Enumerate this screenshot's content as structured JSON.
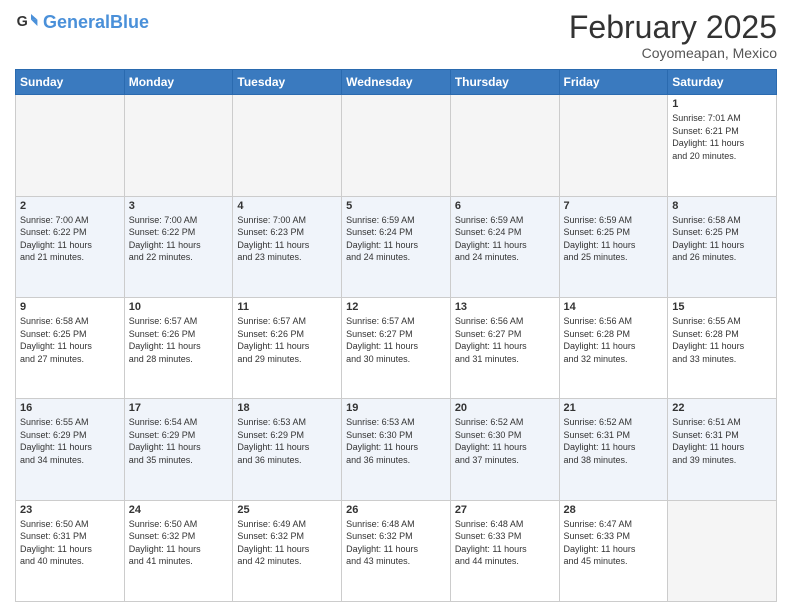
{
  "header": {
    "logo_general": "General",
    "logo_blue": "Blue",
    "month": "February 2025",
    "location": "Coyomeapan, Mexico"
  },
  "days_of_week": [
    "Sunday",
    "Monday",
    "Tuesday",
    "Wednesday",
    "Thursday",
    "Friday",
    "Saturday"
  ],
  "weeks": [
    [
      {
        "day": "",
        "info": ""
      },
      {
        "day": "",
        "info": ""
      },
      {
        "day": "",
        "info": ""
      },
      {
        "day": "",
        "info": ""
      },
      {
        "day": "",
        "info": ""
      },
      {
        "day": "",
        "info": ""
      },
      {
        "day": "1",
        "info": "Sunrise: 7:01 AM\nSunset: 6:21 PM\nDaylight: 11 hours\nand 20 minutes."
      }
    ],
    [
      {
        "day": "2",
        "info": "Sunrise: 7:00 AM\nSunset: 6:22 PM\nDaylight: 11 hours\nand 21 minutes."
      },
      {
        "day": "3",
        "info": "Sunrise: 7:00 AM\nSunset: 6:22 PM\nDaylight: 11 hours\nand 22 minutes."
      },
      {
        "day": "4",
        "info": "Sunrise: 7:00 AM\nSunset: 6:23 PM\nDaylight: 11 hours\nand 23 minutes."
      },
      {
        "day": "5",
        "info": "Sunrise: 6:59 AM\nSunset: 6:24 PM\nDaylight: 11 hours\nand 24 minutes."
      },
      {
        "day": "6",
        "info": "Sunrise: 6:59 AM\nSunset: 6:24 PM\nDaylight: 11 hours\nand 24 minutes."
      },
      {
        "day": "7",
        "info": "Sunrise: 6:59 AM\nSunset: 6:25 PM\nDaylight: 11 hours\nand 25 minutes."
      },
      {
        "day": "8",
        "info": "Sunrise: 6:58 AM\nSunset: 6:25 PM\nDaylight: 11 hours\nand 26 minutes."
      }
    ],
    [
      {
        "day": "9",
        "info": "Sunrise: 6:58 AM\nSunset: 6:25 PM\nDaylight: 11 hours\nand 27 minutes."
      },
      {
        "day": "10",
        "info": "Sunrise: 6:57 AM\nSunset: 6:26 PM\nDaylight: 11 hours\nand 28 minutes."
      },
      {
        "day": "11",
        "info": "Sunrise: 6:57 AM\nSunset: 6:26 PM\nDaylight: 11 hours\nand 29 minutes."
      },
      {
        "day": "12",
        "info": "Sunrise: 6:57 AM\nSunset: 6:27 PM\nDaylight: 11 hours\nand 30 minutes."
      },
      {
        "day": "13",
        "info": "Sunrise: 6:56 AM\nSunset: 6:27 PM\nDaylight: 11 hours\nand 31 minutes."
      },
      {
        "day": "14",
        "info": "Sunrise: 6:56 AM\nSunset: 6:28 PM\nDaylight: 11 hours\nand 32 minutes."
      },
      {
        "day": "15",
        "info": "Sunrise: 6:55 AM\nSunset: 6:28 PM\nDaylight: 11 hours\nand 33 minutes."
      }
    ],
    [
      {
        "day": "16",
        "info": "Sunrise: 6:55 AM\nSunset: 6:29 PM\nDaylight: 11 hours\nand 34 minutes."
      },
      {
        "day": "17",
        "info": "Sunrise: 6:54 AM\nSunset: 6:29 PM\nDaylight: 11 hours\nand 35 minutes."
      },
      {
        "day": "18",
        "info": "Sunrise: 6:53 AM\nSunset: 6:29 PM\nDaylight: 11 hours\nand 36 minutes."
      },
      {
        "day": "19",
        "info": "Sunrise: 6:53 AM\nSunset: 6:30 PM\nDaylight: 11 hours\nand 36 minutes."
      },
      {
        "day": "20",
        "info": "Sunrise: 6:52 AM\nSunset: 6:30 PM\nDaylight: 11 hours\nand 37 minutes."
      },
      {
        "day": "21",
        "info": "Sunrise: 6:52 AM\nSunset: 6:31 PM\nDaylight: 11 hours\nand 38 minutes."
      },
      {
        "day": "22",
        "info": "Sunrise: 6:51 AM\nSunset: 6:31 PM\nDaylight: 11 hours\nand 39 minutes."
      }
    ],
    [
      {
        "day": "23",
        "info": "Sunrise: 6:50 AM\nSunset: 6:31 PM\nDaylight: 11 hours\nand 40 minutes."
      },
      {
        "day": "24",
        "info": "Sunrise: 6:50 AM\nSunset: 6:32 PM\nDaylight: 11 hours\nand 41 minutes."
      },
      {
        "day": "25",
        "info": "Sunrise: 6:49 AM\nSunset: 6:32 PM\nDaylight: 11 hours\nand 42 minutes."
      },
      {
        "day": "26",
        "info": "Sunrise: 6:48 AM\nSunset: 6:32 PM\nDaylight: 11 hours\nand 43 minutes."
      },
      {
        "day": "27",
        "info": "Sunrise: 6:48 AM\nSunset: 6:33 PM\nDaylight: 11 hours\nand 44 minutes."
      },
      {
        "day": "28",
        "info": "Sunrise: 6:47 AM\nSunset: 6:33 PM\nDaylight: 11 hours\nand 45 minutes."
      },
      {
        "day": "",
        "info": ""
      }
    ]
  ]
}
